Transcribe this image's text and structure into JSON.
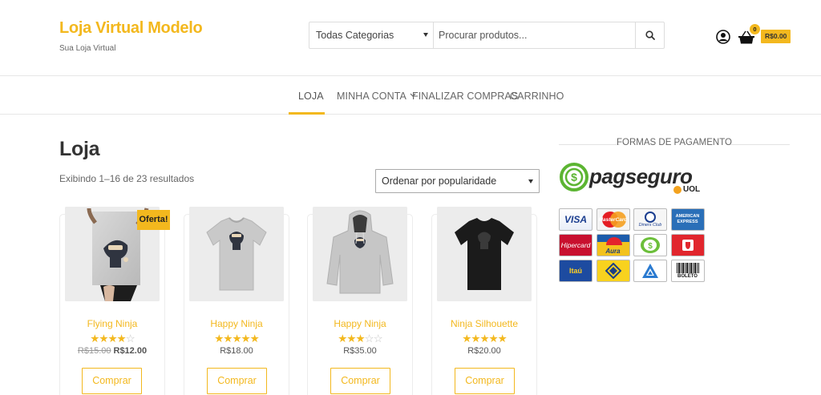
{
  "header": {
    "site_title": "Loja Virtual Modelo",
    "tagline": "Sua Loja Virtual",
    "search": {
      "category": "Todas Categorias",
      "placeholder": "Procurar produtos..."
    },
    "cart": {
      "count": "0",
      "total": "R$0.00"
    }
  },
  "nav": {
    "items": [
      {
        "label": "Loja",
        "active": true
      },
      {
        "label": "Minha Conta",
        "has_submenu": true
      },
      {
        "label": "Finalizar Compras"
      },
      {
        "label": "Carrinho"
      }
    ]
  },
  "main": {
    "title": "Loja",
    "result_count": "Exibindo 1–16 de 23 resultados",
    "ordering": "Ordenar por popularidade",
    "products": [
      {
        "name": "Flying Ninja",
        "rating": 4,
        "old_price": "R$15.00",
        "price": "R$12.00",
        "on_sale": true,
        "sale_label": "Oferta!",
        "button": "Comprar"
      },
      {
        "name": "Happy Ninja",
        "rating": 5,
        "price": "R$18.00",
        "button": "Comprar"
      },
      {
        "name": "Happy Ninja",
        "rating": 3,
        "price": "R$35.00",
        "button": "Comprar"
      },
      {
        "name": "Ninja Silhouette",
        "rating": 5,
        "price": "R$20.00",
        "button": "Comprar"
      }
    ]
  },
  "sidebar": {
    "widget_title": "Formas de Pagamento",
    "pagseguro_text": "pagseguro",
    "uol_text": "UOL",
    "payment_methods": [
      {
        "name": "visa",
        "label": "VISA"
      },
      {
        "name": "mastercard",
        "label": "MasterCard"
      },
      {
        "name": "diners",
        "label": "Diners Club"
      },
      {
        "name": "amex",
        "label": "AMERICAN EXPRESS"
      },
      {
        "name": "hipercard",
        "label": "Hipercard"
      },
      {
        "name": "aura",
        "label": "Aura"
      },
      {
        "name": "elo",
        "label": ""
      },
      {
        "name": "pagseguro-saldo",
        "label": ""
      },
      {
        "name": "itau",
        "label": "Itaú"
      },
      {
        "name": "banco-do-brasil",
        "label": ""
      },
      {
        "name": "banrisul",
        "label": ""
      },
      {
        "name": "boleto",
        "label": "BOLETO"
      }
    ]
  },
  "colors": {
    "accent": "#f3b81e"
  }
}
